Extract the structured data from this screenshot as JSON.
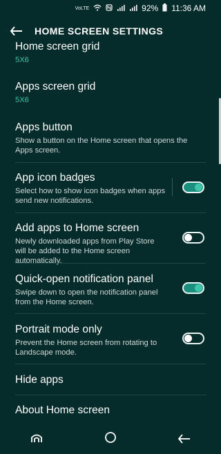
{
  "status_bar": {
    "volte": "VoLTE",
    "battery_pct": "92%",
    "time": "11:36 AM",
    "icons": [
      "volte-icon",
      "wifi-icon",
      "nfc-icon",
      "signal-icon",
      "signal-icon",
      "battery-icon"
    ]
  },
  "app_bar": {
    "title": "HOME SCREEN SETTINGS",
    "back_icon": "back-arrow-icon"
  },
  "settings": [
    {
      "title": "Home screen grid",
      "value": "5X6"
    },
    {
      "title": "Apps screen grid",
      "value": "5X6"
    },
    {
      "title": "Apps button",
      "subtitle": "Show a button on the Home screen that opens the Apps screen."
    },
    {
      "title": "App icon badges",
      "subtitle": "Select how to show icon badges when apps send new notifications.",
      "toggle": true
    },
    {
      "title": "Add apps to Home screen",
      "subtitle": "Newly downloaded apps from Play Store will be added to the Home screen automatically.",
      "toggle": false
    },
    {
      "title": "Quick-open notification panel",
      "subtitle": "Swipe down to open the notification panel from the Home screen.",
      "toggle": true
    },
    {
      "title": "Portrait mode only",
      "subtitle": "Prevent the Home screen from rotating to Landscape mode.",
      "toggle": false
    },
    {
      "title": "Hide apps"
    },
    {
      "title": "About Home screen"
    }
  ],
  "nav_bar": {
    "icons": [
      "recent-apps-icon",
      "home-icon",
      "back-icon"
    ]
  },
  "colors": {
    "background": "#052c2a",
    "accent": "#36c7a8",
    "toggle_on": "#1a8f7e"
  }
}
